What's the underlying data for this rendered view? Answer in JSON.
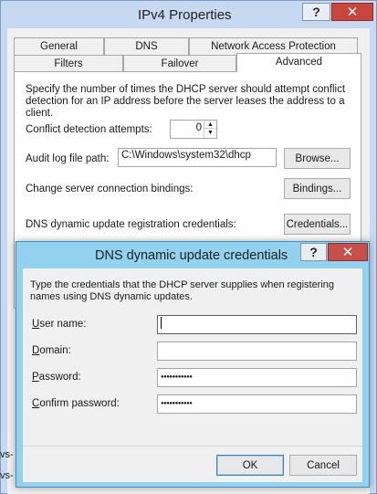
{
  "outer_window": {
    "title": "IPv4 Properties",
    "help_glyph": "?",
    "close_glyph": "✕"
  },
  "tabs": {
    "row_back": [
      "General",
      "DNS",
      "Network Access Protection"
    ],
    "row_front": [
      "Filters",
      "Failover",
      "Advanced"
    ],
    "active": "Advanced"
  },
  "advanced": {
    "description": "Specify the number of times the DHCP server should attempt conflict detection for an IP address before the server leases the address to a client.",
    "conflict_label": "Conflict detection attempts:",
    "conflict_value": "0",
    "audit_label": "Audit log file path:",
    "audit_value": "C:\\Windows\\system32\\dhcp",
    "browse_label": "Browse...",
    "bindings_label_text": "Change server connection bindings:",
    "bindings_button": "Bindings...",
    "credentials_label_text": "DNS dynamic update registration credentials:",
    "credentials_button": "Credentials..."
  },
  "dialog": {
    "title": "DNS dynamic update credentials",
    "help_glyph": "?",
    "close_glyph": "✕",
    "description": "Type the credentials that the DHCP server supplies when registering names using DNS dynamic updates.",
    "fields": {
      "username": {
        "label_key": "U",
        "label_rest": "ser name:",
        "value": ""
      },
      "domain": {
        "label_key": "D",
        "label_rest": "omain:",
        "value": ""
      },
      "password": {
        "label_key": "P",
        "label_rest": "assword:",
        "value": "●●●●●●●●●●●"
      },
      "confirm": {
        "label_key": "C",
        "label_rest": "onfirm password:",
        "value": "●●●●●●●●●●●"
      }
    },
    "ok_label": "OK",
    "cancel_label": "Cancel"
  },
  "background_fragments": {
    "left_1": "vs-",
    "left_2": "vs-"
  },
  "colors": {
    "outer_frame": "#c7d9f0",
    "dialog_frame": "#93d2ee",
    "close_red": "#c9463d",
    "default_button_border": "#3c7fb1"
  }
}
